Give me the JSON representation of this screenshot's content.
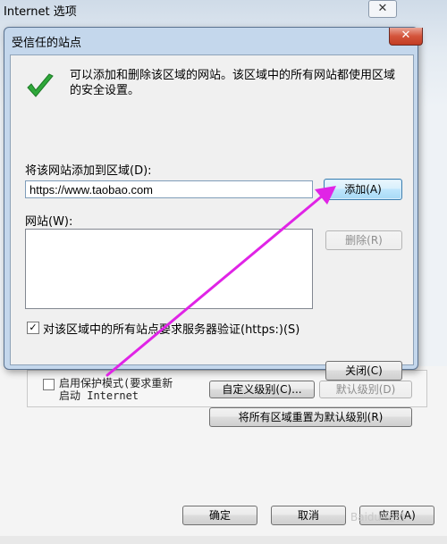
{
  "background_window": {
    "title": "Internet 选项",
    "close_glyph": "✕",
    "protected_mode_label_1": "启用保护模式(要求重新",
    "protected_mode_label_2": "启动 Internet",
    "custom_level_button": "自定义级别(C)...",
    "default_level_button": "默认级别(D)",
    "reset_all_button": "将所有区域重置为默认级别(R)",
    "ok_button": "确定",
    "cancel_button": "取消",
    "apply_button": "应用(A)",
    "watermark": "Baidu 经验"
  },
  "dialog": {
    "title": "受信任的站点",
    "close_glyph": "✕",
    "description": "可以添加和删除该区域的网站。该区域中的所有网站都使用区域的安全设置。",
    "add_label": "将该网站添加到区域(D):",
    "url_value": "https://www.taobao.com",
    "add_button": "添加(A)",
    "websites_label": "网站(W):",
    "remove_button": "删除(R)",
    "verify_checked": true,
    "verify_mark": "✓",
    "verify_label": "对该区域中的所有站点要求服务器验证(https:)(S)",
    "close_button": "关闭(C)"
  },
  "annotation": {
    "arrow_color": "#e024e6"
  }
}
